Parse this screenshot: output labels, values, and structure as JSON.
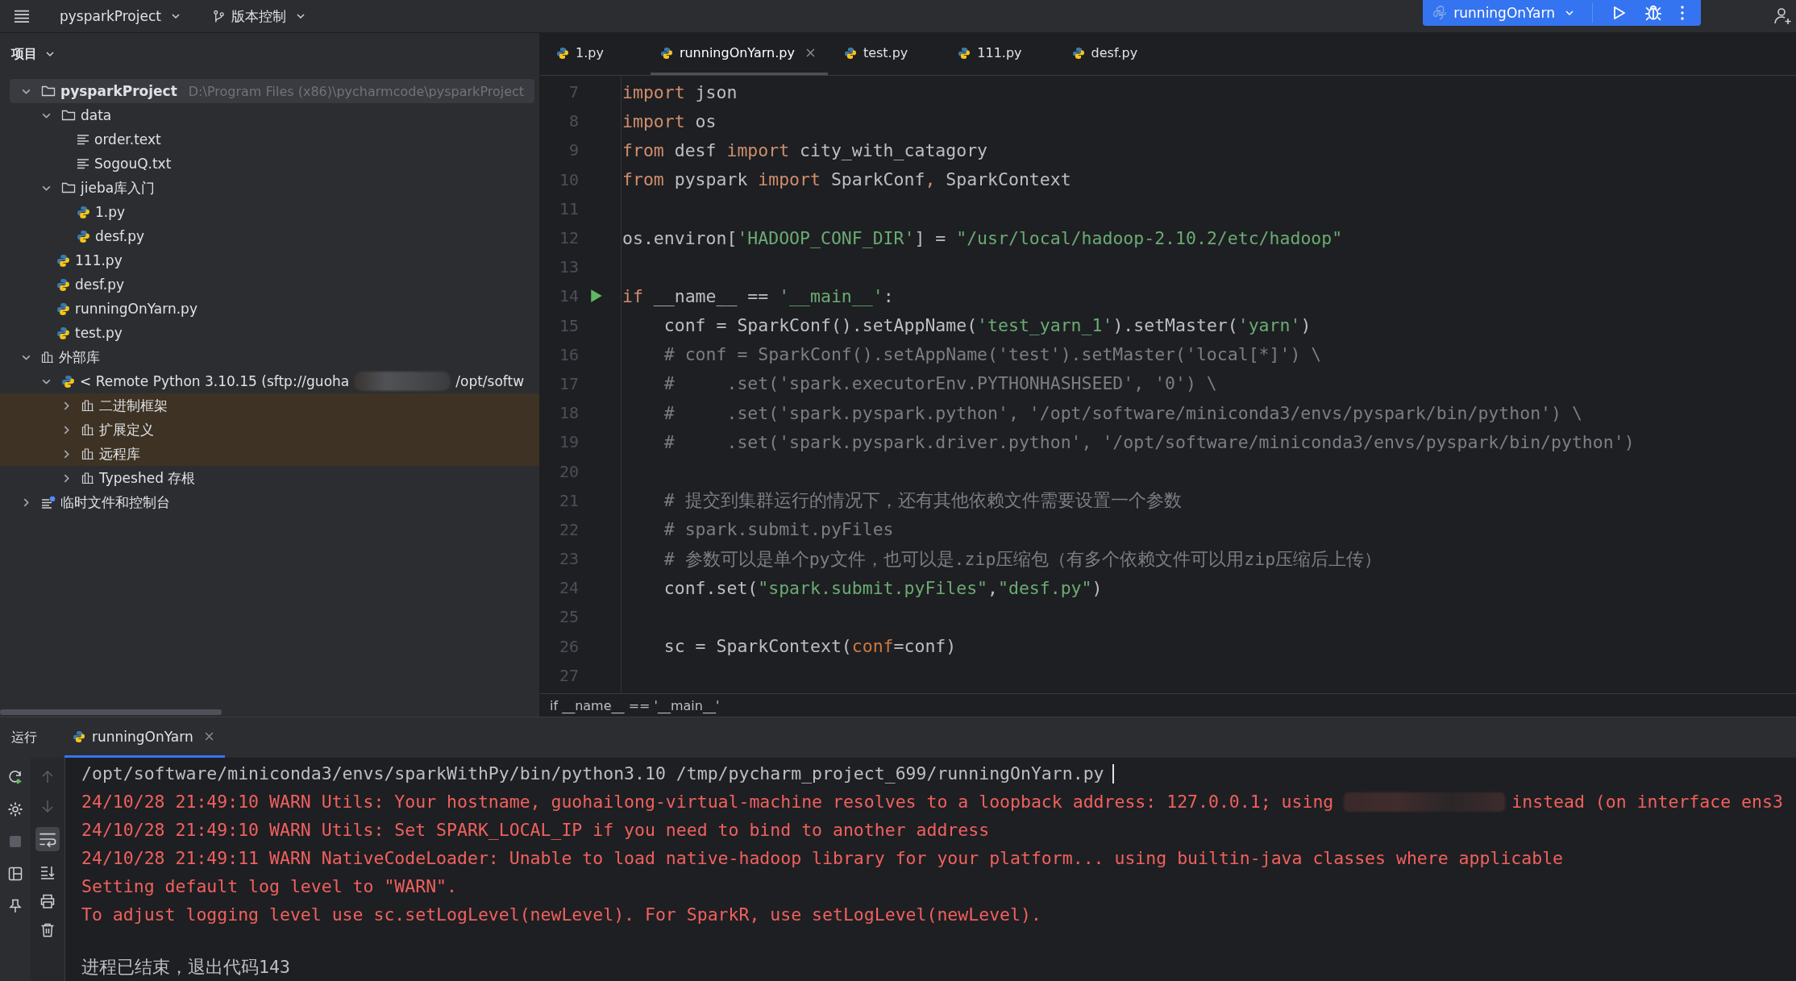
{
  "top_bar": {
    "project": "pysparkProject",
    "vcs": "版本控制",
    "run_config": "runningOnYarn"
  },
  "project_panel": {
    "title": "项目",
    "tree": [
      {
        "name": [
          "pysparkProject"
        ],
        "path": "D:\\Program Files (x86)\\pycharmcode\\pysparkProject",
        "kind": "folder",
        "expanded": true,
        "selected": true,
        "highlighted": false,
        "children": [
          {
            "name": [
              "data"
            ],
            "kind": "folder",
            "expanded": true,
            "selected": false,
            "highlighted": false,
            "children": [
              {
                "name": [
                  "order.text"
                ],
                "kind": "text",
                "selected": false,
                "highlighted": false
              },
              {
                "name": [
                  "SogouQ.txt"
                ],
                "kind": "text",
                "selected": false,
                "highlighted": false
              }
            ]
          },
          {
            "name": [
              "jieba库入门"
            ],
            "kind": "folder",
            "expanded": true,
            "selected": false,
            "highlighted": false,
            "children": [
              {
                "name": [
                  "1.py"
                ],
                "kind": "python",
                "selected": false,
                "highlighted": false
              },
              {
                "name": [
                  "desf.py"
                ],
                "kind": "python",
                "selected": false,
                "highlighted": false
              }
            ]
          },
          {
            "name": [
              "111.py"
            ],
            "kind": "python",
            "selected": false,
            "highlighted": false
          },
          {
            "name": [
              "desf.py"
            ],
            "kind": "python",
            "selected": false,
            "highlighted": false
          },
          {
            "name": [
              "runningOnYarn.py"
            ],
            "kind": "python",
            "selected": false,
            "highlighted": false
          },
          {
            "name": [
              "test.py"
            ],
            "kind": "python",
            "selected": false,
            "highlighted": false
          }
        ]
      },
      {
        "name": [
          "外部库"
        ],
        "kind": "library",
        "expanded": true,
        "selected": false,
        "highlighted": false,
        "children": [
          {
            "name": [
              "< Remote Python 3.10.15 (sftp://guoha",
              "/opt/softw"
            ],
            "kind": "python",
            "expanded": true,
            "selected": false,
            "highlighted": false,
            "children": [
              {
                "name": [
                  "二进制框架"
                ],
                "kind": "library",
                "expanded": false,
                "selected": false,
                "highlighted": true
              },
              {
                "name": [
                  "扩展定义"
                ],
                "kind": "library",
                "expanded": false,
                "selected": false,
                "highlighted": true
              },
              {
                "name": [
                  "远程库"
                ],
                "kind": "library",
                "expanded": false,
                "selected": false,
                "highlighted": true
              },
              {
                "name": [
                  "Typeshed 存根"
                ],
                "kind": "library",
                "expanded": false,
                "selected": false,
                "highlighted": false
              }
            ]
          }
        ]
      },
      {
        "name": [
          "临时文件和控制台"
        ],
        "kind": "scratch",
        "expanded": false,
        "selected": false,
        "highlighted": false
      }
    ]
  },
  "editor": {
    "tabs": [
      {
        "label": "1.py",
        "selected": false
      },
      {
        "label": "runningOnYarn.py",
        "selected": true
      },
      {
        "label": "test.py",
        "selected": false
      },
      {
        "label": "111.py",
        "selected": false
      },
      {
        "label": "desf.py",
        "selected": false
      }
    ],
    "lines": [
      {
        "num": "7",
        "run_marker": false,
        "tokens": [
          {
            "t": "import",
            "kind": "kw"
          },
          {
            "t": " json",
            "kind": "id"
          }
        ]
      },
      {
        "num": "8",
        "run_marker": false,
        "tokens": [
          {
            "t": "import",
            "kind": "kw"
          },
          {
            "t": " os",
            "kind": "id"
          }
        ]
      },
      {
        "num": "9",
        "run_marker": false,
        "tokens": [
          {
            "t": "from",
            "kind": "kw"
          },
          {
            "t": " desf ",
            "kind": "id"
          },
          {
            "t": "import",
            "kind": "kw"
          },
          {
            "t": " city_with_catagory",
            "kind": "id"
          }
        ]
      },
      {
        "num": "10",
        "run_marker": false,
        "tokens": [
          {
            "t": "from",
            "kind": "kw"
          },
          {
            "t": " pyspark ",
            "kind": "id"
          },
          {
            "t": "import",
            "kind": "kw"
          },
          {
            "t": " SparkConf",
            "kind": "id"
          },
          {
            "t": ",",
            "kind": "kw"
          },
          {
            "t": " SparkContext",
            "kind": "id"
          }
        ]
      },
      {
        "num": "11",
        "run_marker": false
      },
      {
        "num": "12",
        "run_marker": false,
        "tokens": [
          {
            "t": "os.environ[",
            "kind": "id"
          },
          {
            "t": "'HADOOP_CONF_DIR'",
            "kind": "str"
          },
          {
            "t": "] = ",
            "kind": "id"
          },
          {
            "t": "\"/usr/local/hadoop-2.10.2/etc/hadoop\"",
            "kind": "str"
          }
        ]
      },
      {
        "num": "13",
        "run_marker": false
      },
      {
        "num": "14",
        "run_marker": true,
        "tokens": [
          {
            "t": "if",
            "kind": "kw"
          },
          {
            "t": " __name__ == ",
            "kind": "id"
          },
          {
            "t": "'__main__'",
            "kind": "str"
          },
          {
            "t": ":",
            "kind": "id"
          }
        ]
      },
      {
        "num": "15",
        "run_marker": false,
        "tokens": [
          {
            "t": "    conf = SparkConf().setAppName(",
            "kind": "id"
          },
          {
            "t": "'test_yarn_1'",
            "kind": "str"
          },
          {
            "t": ").setMaster(",
            "kind": "id"
          },
          {
            "t": "'yarn'",
            "kind": "str"
          },
          {
            "t": ")",
            "kind": "id"
          }
        ]
      },
      {
        "num": "16",
        "run_marker": false,
        "tokens": [
          {
            "t": "    # conf = SparkConf().setAppName('test').setMaster('local[*]') \\",
            "kind": "cm"
          }
        ]
      },
      {
        "num": "17",
        "run_marker": false,
        "tokens": [
          {
            "t": "    #     .set('spark.executorEnv.PYTHONHASHSEED', '0') \\",
            "kind": "cm"
          }
        ]
      },
      {
        "num": "18",
        "run_marker": false,
        "tokens": [
          {
            "t": "    #     .set('spark.pyspark.python', '/opt/software/miniconda3/envs/pyspark/bin/python') \\",
            "kind": "cm"
          }
        ]
      },
      {
        "num": "19",
        "run_marker": false,
        "tokens": [
          {
            "t": "    #     .set('spark.pyspark.driver.python', '/opt/software/miniconda3/envs/pyspark/bin/python')",
            "kind": "cm"
          }
        ]
      },
      {
        "num": "20",
        "run_marker": false
      },
      {
        "num": "21",
        "run_marker": false,
        "tokens": [
          {
            "t": "    # 提交到集群运行的情况下，还有其他依赖文件需要设置一个参数",
            "kind": "cm"
          }
        ]
      },
      {
        "num": "22",
        "run_marker": false,
        "tokens": [
          {
            "t": "    # spark.submit.pyFiles",
            "kind": "cm"
          }
        ]
      },
      {
        "num": "23",
        "run_marker": false,
        "tokens": [
          {
            "t": "    # 参数可以是单个py文件，也可以是.zip压缩包（有多个依赖文件可以用zip压缩后上传）",
            "kind": "cm"
          }
        ]
      },
      {
        "num": "24",
        "run_marker": false,
        "tokens": [
          {
            "t": "    conf.set(",
            "kind": "id"
          },
          {
            "t": "\"spark.submit.pyFiles\"",
            "kind": "str"
          },
          {
            "t": ",",
            "kind": "id"
          },
          {
            "t": "\"desf.py\"",
            "kind": "str"
          },
          {
            "t": ")",
            "kind": "id"
          }
        ]
      },
      {
        "num": "25",
        "run_marker": false
      },
      {
        "num": "26",
        "run_marker": false,
        "tokens": [
          {
            "t": "    sc = SparkContext(",
            "kind": "id"
          },
          {
            "t": "conf",
            "kind": "param"
          },
          {
            "t": "=conf)",
            "kind": "id"
          }
        ]
      },
      {
        "num": "27",
        "run_marker": false
      }
    ],
    "breadcrumb": "if __name__ == '__main__'"
  },
  "run_panel": {
    "title": "运行",
    "tabs": [
      {
        "label": "runningOnYarn",
        "selected": true
      }
    ],
    "console": [
      {
        "kind": "command",
        "parts": [
          "/opt/software/miniconda3/envs/sparkWithPy/bin/python3.10 /tmp/pycharm_project_699/runningOnYarn.py"
        ]
      },
      {
        "kind": "error",
        "parts": [
          "24/10/28 21:49:10 WARN Utils: Your hostname, guohailong-virtual-machine resolves to a loopback address: 127.0.0.1; using",
          "instead (on interface ens3"
        ]
      },
      {
        "kind": "error",
        "parts": [
          "24/10/28 21:49:10 WARN Utils: Set SPARK_LOCAL_IP if you need to bind to another address"
        ]
      },
      {
        "kind": "error",
        "parts": [
          "24/10/28 21:49:11 WARN NativeCodeLoader: Unable to load native-hadoop library for your platform... using builtin-java classes where applicable"
        ]
      },
      {
        "kind": "error",
        "parts": [
          "Setting default log level to \"WARN\"."
        ]
      },
      {
        "kind": "error",
        "parts": [
          "To adjust logging level use sc.setLogLevel(newLevel). For SparkR, use setLogLevel(newLevel)."
        ]
      },
      {
        "kind": "status",
        "parts": [
          "进程已结束，退出代码143"
        ]
      }
    ]
  }
}
